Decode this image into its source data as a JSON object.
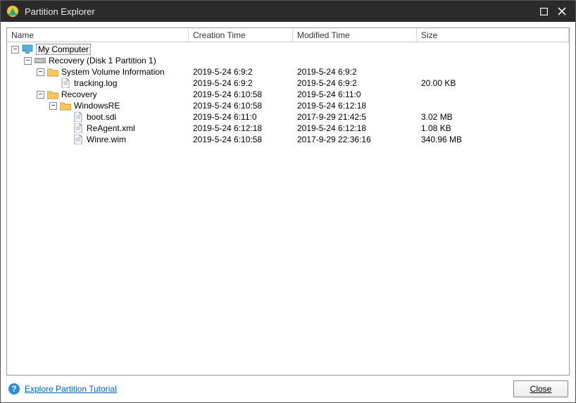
{
  "window": {
    "title": "Partition Explorer"
  },
  "columns": {
    "name": "Name",
    "ctime": "Creation Time",
    "mtime": "Modified Time",
    "size": "Size"
  },
  "tree": {
    "root": {
      "label": "My Computer",
      "children": {
        "disk": {
          "label": "Recovery (Disk 1 Partition 1)",
          "sysvol": {
            "label": "System Volume Information",
            "ctime": "2019-5-24 6:9:2",
            "mtime": "2019-5-24 6:9:2",
            "tracking": {
              "label": "tracking.log",
              "ctime": "2019-5-24 6:9:2",
              "mtime": "2019-5-24 6:9:2",
              "size": "20.00 KB"
            }
          },
          "recovery": {
            "label": "Recovery",
            "ctime": "2019-5-24 6:10:58",
            "mtime": "2019-5-24 6:11:0",
            "windowsre": {
              "label": "WindowsRE",
              "ctime": "2019-5-24 6:10:58",
              "mtime": "2019-5-24 6:12:18",
              "bootsdi": {
                "label": "boot.sdi",
                "ctime": "2019-5-24 6:11:0",
                "mtime": "2017-9-29 21:42:5",
                "size": "3.02 MB"
              },
              "reagentxml": {
                "label": "ReAgent.xml",
                "ctime": "2019-5-24 6:12:18",
                "mtime": "2019-5-24 6:12:18",
                "size": "1.08 KB"
              },
              "winrewim": {
                "label": "Winre.wim",
                "ctime": "2019-5-24 6:10:58",
                "mtime": "2017-9-29 22:36:16",
                "size": "340.96 MB"
              }
            }
          }
        }
      }
    }
  },
  "footer": {
    "link": "Explore Partition Tutorial",
    "close": "Close"
  }
}
